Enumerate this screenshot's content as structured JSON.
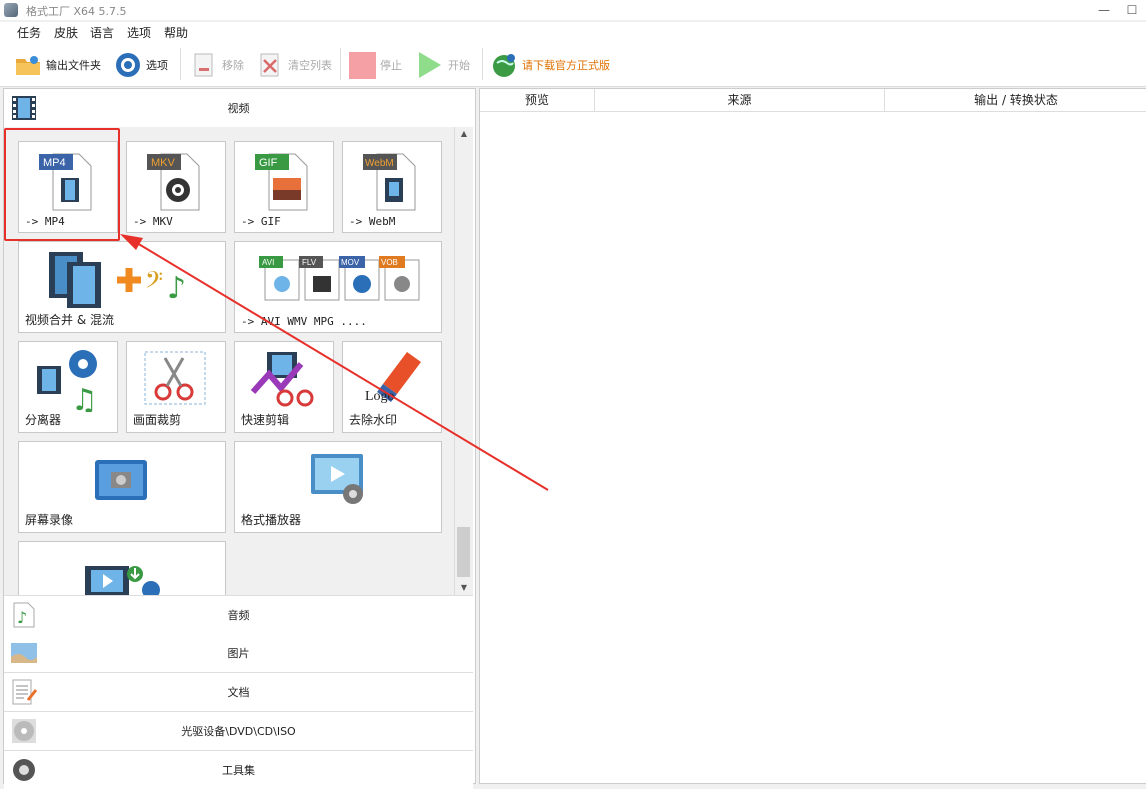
{
  "window": {
    "title": "格式工厂 X64 5.7.5",
    "minimize": "—",
    "maximize": "☐"
  },
  "menu": [
    "任务",
    "皮肤",
    "语言",
    "选项",
    "帮助"
  ],
  "toolbar": {
    "output_folder": "输出文件夹",
    "options": "选项",
    "remove": "移除",
    "clear_list": "清空列表",
    "stop": "停止",
    "start": "开始",
    "download": "请下载官方正式版"
  },
  "categories": {
    "video": "视频",
    "audio": "音频",
    "image": "图片",
    "document": "文档",
    "disc": "光驱设备\\DVD\\CD\\ISO",
    "tools": "工具集"
  },
  "tiles": {
    "mp4": {
      "label": "-> MP4",
      "badge": "MP4"
    },
    "mkv": {
      "label": "-> MKV",
      "badge": "MKV"
    },
    "gif": {
      "label": "-> GIF",
      "badge": "GIF"
    },
    "webm": {
      "label": "-> WebM",
      "badge": "WebM"
    },
    "merge": {
      "label": "视频合并 & 混流"
    },
    "multi": {
      "label": "-> AVI WMV MPG ....",
      "badges": [
        "AVI",
        "FLV",
        "MOV",
        "VOB"
      ]
    },
    "splitter": {
      "label": "分离器"
    },
    "crop": {
      "label": "画面裁剪"
    },
    "quick_cut": {
      "label": "快速剪辑"
    },
    "watermark": {
      "label": "去除水印",
      "logo_text": "Logo"
    },
    "screen_rec": {
      "label": "屏幕录像"
    },
    "player": {
      "label": "格式播放器"
    }
  },
  "table": {
    "columns": [
      "预览",
      "来源",
      "输出 / 转换状态"
    ]
  },
  "colors": {
    "highlight": "#e8302a",
    "download_text": "#e07000"
  }
}
